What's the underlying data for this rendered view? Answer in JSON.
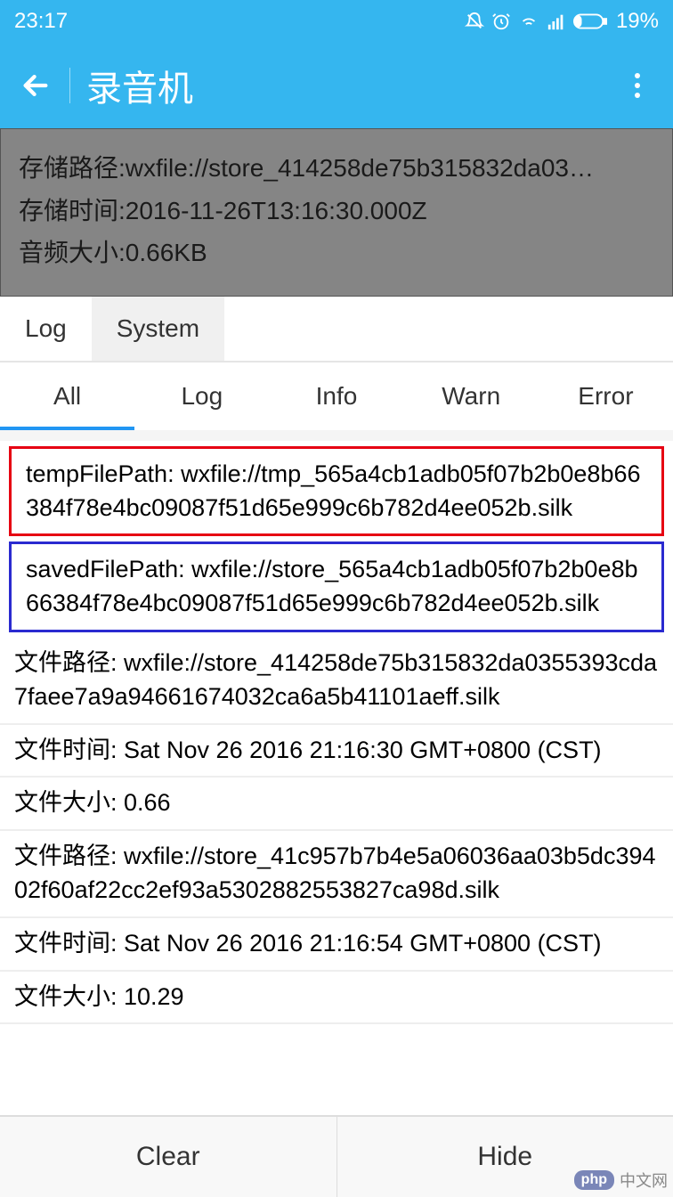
{
  "status": {
    "time": "23:17",
    "battery": "19%",
    "icons": [
      "mute-icon",
      "alarm-icon",
      "wifi-icon",
      "signal-icon",
      "battery-icon"
    ]
  },
  "appbar": {
    "title": "录音机"
  },
  "info": {
    "path_line": "存储路径:wxfile://store_414258de75b315832da03…",
    "time_line": "存储时间:2016-11-26T13:16:30.000Z",
    "size_line": "音频大小:0.66KB"
  },
  "main_tabs": [
    "Log",
    "System"
  ],
  "filter_tabs": [
    "All",
    "Log",
    "Info",
    "Warn",
    "Error"
  ],
  "filter_active_index": 0,
  "logs": [
    {
      "style": "red",
      "text": "tempFilePath: wxfile://tmp_565a4cb1adb05f07b2b0e8b66384f78e4bc09087f51d65e999c6b782d4ee052b.silk"
    },
    {
      "style": "blue",
      "text": "savedFilePath: wxfile://store_565a4cb1adb05f07b2b0e8b66384f78e4bc09087f51d65e999c6b782d4ee052b.silk"
    },
    {
      "style": "",
      "text": "文件路径: wxfile://store_414258de75b315832da0355393cda7faee7a9a94661674032ca6a5b41101aeff.silk"
    },
    {
      "style": "",
      "text": "文件时间: Sat Nov 26 2016 21:16:30 GMT+0800 (CST)"
    },
    {
      "style": "",
      "text": "文件大小: 0.66"
    },
    {
      "style": "",
      "text": "文件路径: wxfile://store_41c957b7b4e5a06036aa03b5dc39402f60af22cc2ef93a5302882553827ca98d.silk"
    },
    {
      "style": "",
      "text": "文件时间: Sat Nov 26 2016 21:16:54 GMT+0800 (CST)"
    },
    {
      "style": "",
      "text": "文件大小: 10.29"
    }
  ],
  "bottom": {
    "clear": "Clear",
    "hide": "Hide"
  },
  "watermark": {
    "badge": "php",
    "text": "中文网"
  }
}
